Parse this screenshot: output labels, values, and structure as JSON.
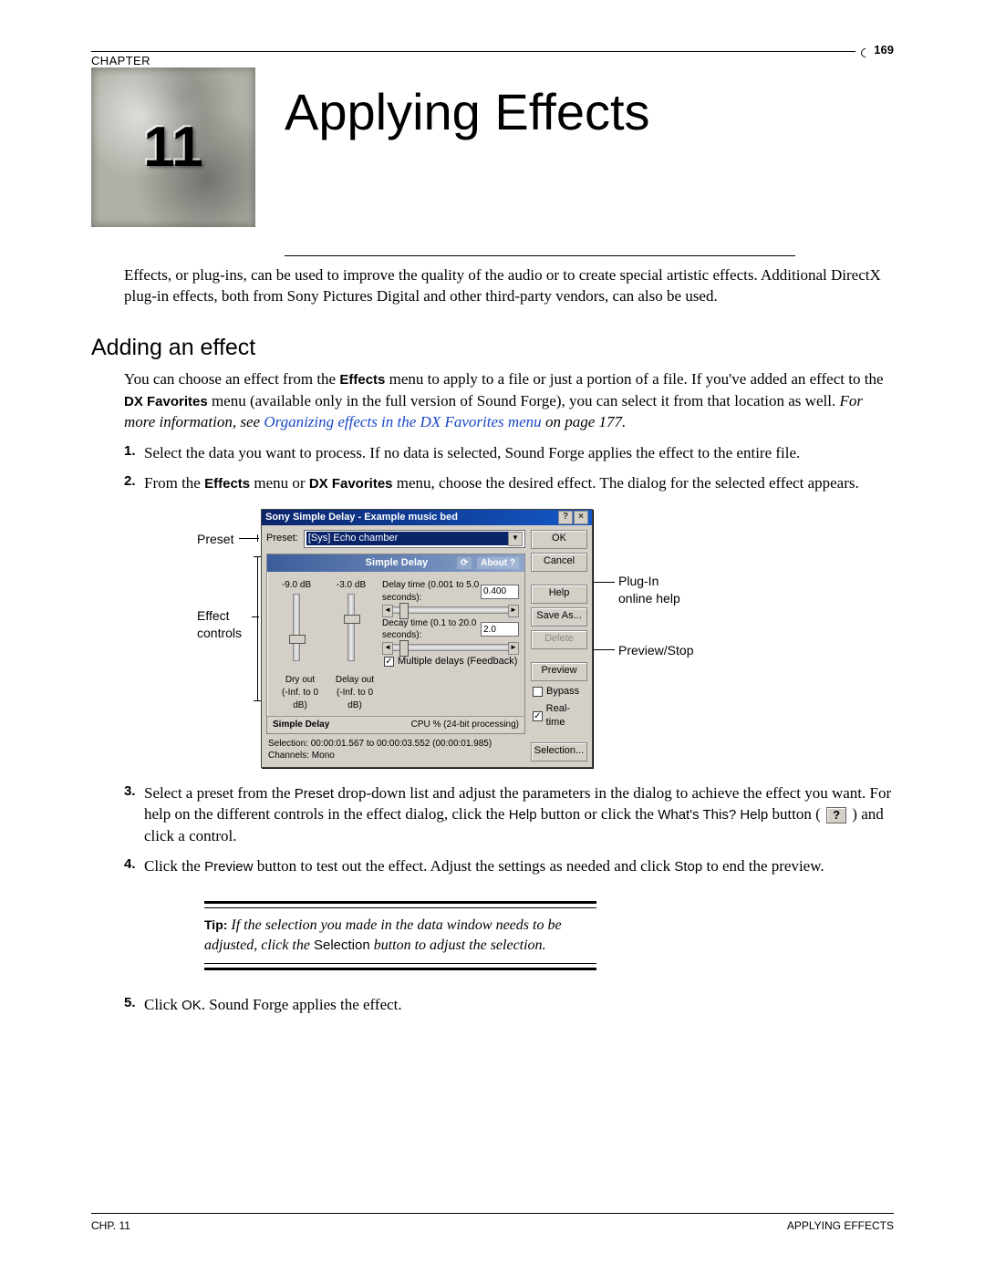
{
  "page_number": "169",
  "chapter_label": "CHAPTER",
  "chapter_number": "11",
  "chapter_title": "Applying Effects",
  "intro": "Effects, or plug-ins, can be used to improve the quality of the audio or to create special artistic effects. Additional DirectX plug-in effects, both from Sony Pictures Digital and other third-party vendors, can also be used.",
  "section_title": "Adding an effect",
  "para1_a": "You can choose an effect from the ",
  "para1_b": "Effects",
  "para1_c": " menu to apply to a file or just a portion of a file. If you've added an effect to the ",
  "para1_d": "DX Favorites",
  "para1_e": " menu (available only in the full version of Sound Forge), you can select it from that location as well. ",
  "para1_f": "For more information, see ",
  "para1_link": "Organizing effects in the DX Favorites menu",
  "para1_g": " on page 177.",
  "steps": {
    "s1": "Select the data you want to process. If no data is selected, Sound Forge applies the effect to the entire file.",
    "s2a": "From the ",
    "s2b": "Effects",
    "s2c": " menu or ",
    "s2d": "DX Favorites",
    "s2e": " menu, choose the desired effect. The dialog for the selected effect appears.",
    "s3a": "Select a preset from the ",
    "s3b": "Preset",
    "s3c": " drop-down list and adjust the parameters in the dialog to achieve the effect you want. For help on the different controls in the effect dialog, click the ",
    "s3d": "Help",
    "s3e": " button or click the ",
    "s3f": "What's This? Help",
    "s3g": " button ( ",
    "s3h": " ) and click a control.",
    "s4a": "Click the ",
    "s4b": "Preview",
    "s4c": " button to test out the effect. Adjust the settings as needed and click ",
    "s4d": "Stop",
    "s4e": " to end the preview.",
    "s5a": "Click ",
    "s5b": "OK",
    "s5c": ". Sound Forge applies the effect."
  },
  "fig_labels": {
    "preset": "Preset",
    "effect_controls": "Effect\ncontrols",
    "plugin_help": "Plug-In\nonline help",
    "preview_stop": "Preview/Stop"
  },
  "dialog": {
    "title": "Sony Simple Delay - Example music bed",
    "preset_label": "Preset:",
    "preset_value": "[Sys] Echo chamber",
    "panel_tab": "Simple Delay",
    "about": "About",
    "dry_val": "-9.0 dB",
    "delay_val": "-3.0 dB",
    "delay_time_label": "Delay time (0.001 to 5.0 seconds):",
    "delay_time_value": "0.400",
    "decay_time_label": "Decay time (0.1 to 20.0 seconds):",
    "decay_time_value": "2.0",
    "multi_label": "Multiple delays (Feedback)",
    "dry_out": "Dry out",
    "delay_out": "Delay out",
    "dry_range": "(-Inf. to 0 dB)",
    "delay_range": "(-Inf. to 0 dB)",
    "foot_left": "Simple Delay",
    "foot_right": "CPU %  (24-bit processing)",
    "selection": "Selection:  00:00:01.567 to 00:00:03.552 (00:00:01.985)",
    "channels": "Channels:  Mono",
    "buttons": {
      "ok": "OK",
      "cancel": "Cancel",
      "help": "Help",
      "save_as": "Save As...",
      "delete": "Delete",
      "preview": "Preview",
      "bypass": "Bypass",
      "realtime": "Real-time",
      "selection": "Selection..."
    }
  },
  "tip": {
    "label": "Tip:",
    "body_a": " If the selection you made in the data window needs to be adjusted, click the ",
    "body_b": "Selection",
    "body_c": " button to adjust the selection."
  },
  "footer_left": "CHP. 11",
  "footer_right": "APPLYING EFFECTS"
}
